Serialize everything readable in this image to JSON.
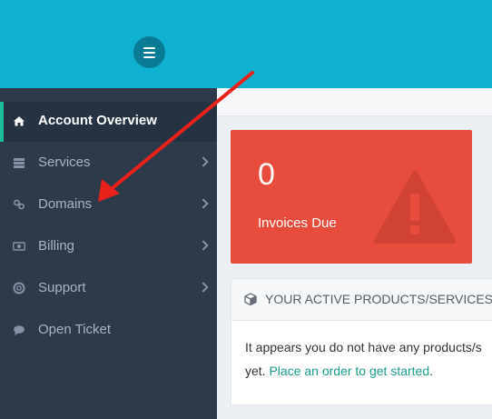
{
  "header": {
    "menu_icon": "hamburger-icon",
    "bg_color": "#0fb0d0"
  },
  "sidebar": {
    "items": [
      {
        "label": "Account Overview",
        "icon": "home-icon",
        "active": true
      },
      {
        "label": "Services",
        "icon": "server-icon",
        "has_submenu": true
      },
      {
        "label": "Domains",
        "icon": "link-icon",
        "has_submenu": true
      },
      {
        "label": "Billing",
        "icon": "money-icon",
        "has_submenu": true
      },
      {
        "label": "Support",
        "icon": "lifebuoy-icon",
        "has_submenu": true
      },
      {
        "label": "Open Ticket",
        "icon": "comment-icon"
      }
    ]
  },
  "invoices_tile": {
    "count": "0",
    "label": "Invoices Due",
    "icon": "warning-icon",
    "color": "#e74c3c"
  },
  "products_panel": {
    "title": "YOUR ACTIVE PRODUCTS/SERVICES",
    "icon": "cube-icon",
    "message_line1": "It appears you do not have any products/s",
    "message_prefix": "yet.",
    "link_text": "Place an order to get started",
    "message_suffix": "."
  },
  "annotation": {
    "arrow_color": "#e8221a"
  }
}
